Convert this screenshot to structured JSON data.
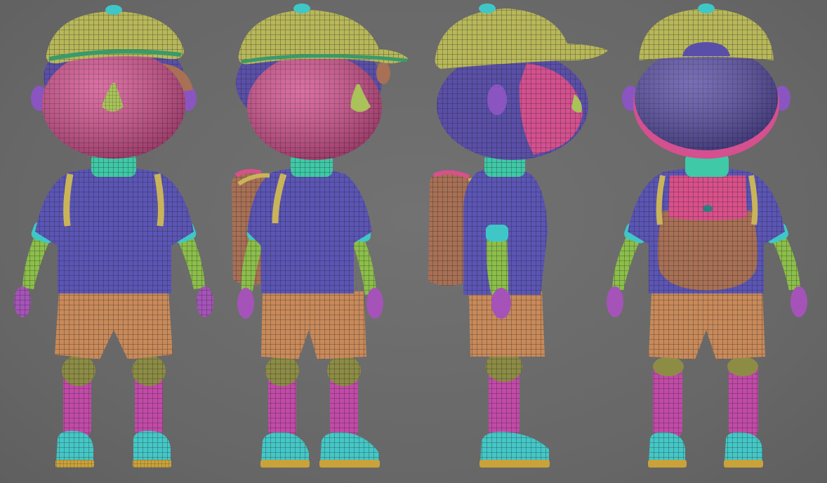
{
  "viewport": {
    "background": "#6a6a6a",
    "views": [
      "front",
      "three-quarter",
      "side",
      "back"
    ]
  },
  "polygroup_colors": {
    "cap": "#b8b85a",
    "cap_brim_edge": "#3a9a6a",
    "cap_button": "#3fc7c7",
    "face": "#d4508f",
    "hair": "#5a4fa8",
    "ear": "#8a55c0",
    "nose": "#a9c25a",
    "neck": "#3fc9a6",
    "shirt": "#5b55b5",
    "sleeve_cuff": "#3fc7c7",
    "arm": "#8cbf4a",
    "hand": "#a553b8",
    "shorts": "#c98a5a",
    "knee": "#8c8c45",
    "sock": "#c24aa8",
    "shoe": "#45c7c7",
    "sole": "#c9a23a",
    "strap": "#c9b45a",
    "backpack": "#a87055",
    "backpack_flap": "#d9508a",
    "wireframe": "#1e1e1e"
  }
}
